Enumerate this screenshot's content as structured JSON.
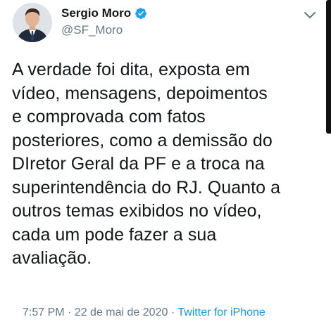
{
  "author": {
    "name": "Sergio Moro",
    "handle": "@SF_Moro",
    "verified": true,
    "avatar_icon": "profile-photo-avatar"
  },
  "tweet": {
    "lines": [
      "A verdade foi dita, exposta em",
      "vídeo, mensagens, depoimentos",
      "e comprovada com fatos",
      "posteriores, como a demissão do",
      "DIretor Geral da PF e a troca na",
      "superintendência do RJ. Quanto a",
      "outros temas exibidos no vídeo,",
      "cada um pode fazer a sua",
      "avaliação."
    ]
  },
  "meta": {
    "time": "7:57 PM",
    "separator1": " · ",
    "date": "22 de mai de 2020",
    "separator2": " · ",
    "source": "Twitter for iPhone"
  },
  "icons": {
    "verified": "verified-badge-icon",
    "menu": "chevron-down-icon"
  },
  "colors": {
    "text": "#14171a",
    "secondary": "#657786",
    "link": "#1b95e0",
    "verified": "#1da1f2"
  }
}
